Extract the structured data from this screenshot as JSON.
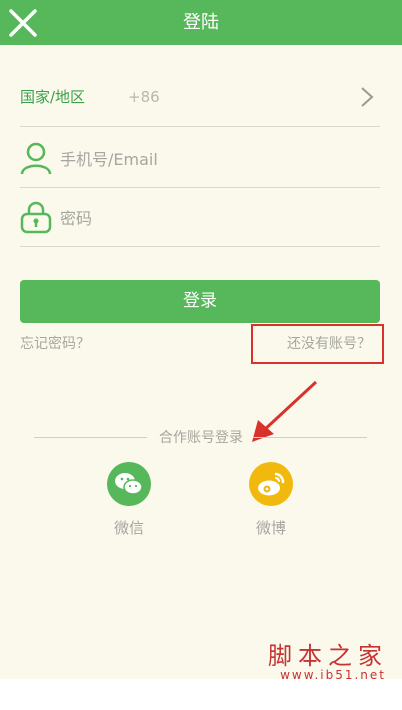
{
  "header": {
    "title": "登陆",
    "close_icon": "close-icon"
  },
  "country": {
    "label": "国家/地区",
    "code": "+86",
    "chevron_icon": "chevron-right-icon"
  },
  "phone": {
    "placeholder": "手机号/Email",
    "icon": "user-icon"
  },
  "password": {
    "placeholder": "密码",
    "icon": "lock-icon"
  },
  "login_button": "登录",
  "forgot_password": "忘记密码？",
  "no_account": "还没有账号？",
  "partner_login": "合作账号登录",
  "social": [
    {
      "label": "微信",
      "icon": "wechat-icon",
      "color": "#56b85a"
    },
    {
      "label": "微博",
      "icon": "weibo-icon",
      "color": "#f1b90d"
    }
  ],
  "watermark": {
    "text": "脚本之家",
    "url": "www.jb51.net"
  },
  "colors": {
    "brand_green": "#56b85a",
    "annotation_red": "#d9322c",
    "background": "#fbf9ec"
  }
}
